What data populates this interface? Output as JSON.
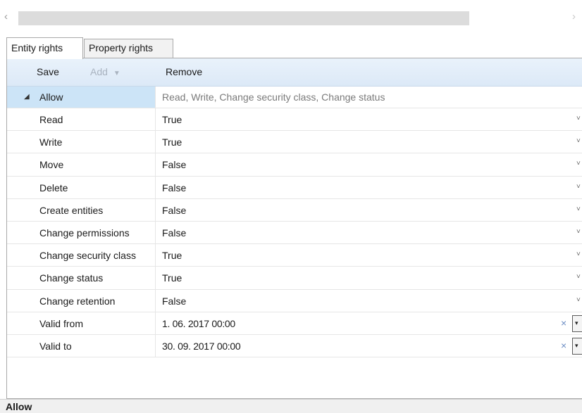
{
  "scrollbar": {
    "left_arrow": "‹",
    "right_arrow": "›"
  },
  "tabs": [
    {
      "label": "Entity rights",
      "active": true
    },
    {
      "label": "Property rights",
      "active": false
    }
  ],
  "toolbar": {
    "save_label": "Save",
    "add_label": "Add",
    "add_caret": "▼",
    "remove_label": "Remove"
  },
  "grid": {
    "group": {
      "expander": "◢",
      "name": "Allow",
      "summary": "Read, Write, Change security class, Change status"
    },
    "rows": [
      {
        "name": "Read",
        "value": "True"
      },
      {
        "name": "Write",
        "value": "True"
      },
      {
        "name": "Move",
        "value": "False"
      },
      {
        "name": "Delete",
        "value": "False"
      },
      {
        "name": "Create entities",
        "value": "False"
      },
      {
        "name": "Change permissions",
        "value": "False"
      },
      {
        "name": "Change security class",
        "value": "True"
      },
      {
        "name": "Change status",
        "value": "True"
      },
      {
        "name": "Change retention",
        "value": "False"
      }
    ],
    "date_rows": [
      {
        "name": "Valid from",
        "value": "1. 06. 2017 00:00"
      },
      {
        "name": "Valid to",
        "value": "30. 09. 2017 00:00"
      }
    ],
    "chevron": "˅",
    "clear_icon": "×",
    "dropdown_icon": "▾"
  },
  "status": {
    "label": "Allow"
  },
  "colors": {
    "selected_cell": "#cce4f7",
    "toolbar": "#dce9f7",
    "clear_icon": "#6d8ec4"
  }
}
